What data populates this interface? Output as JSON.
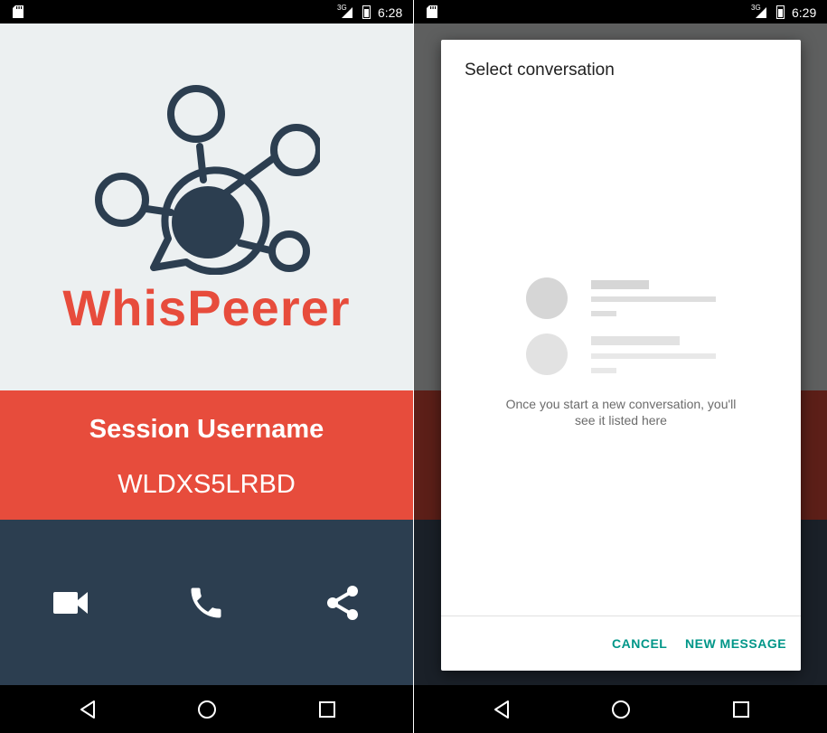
{
  "colors": {
    "brand_red": "#e74c3c",
    "dark_blue": "#2c3e50",
    "light_bg": "#ecf0f1",
    "accent_teal": "#009688"
  },
  "left_screen": {
    "status": {
      "time": "6:28",
      "network": "3G"
    },
    "brand_name": "WhisPeerer",
    "session_label": "Session Username",
    "session_username": "WLDXS5LRBD",
    "actions": [
      {
        "icon": "video-camera-icon"
      },
      {
        "icon": "phone-icon"
      },
      {
        "icon": "share-icon"
      }
    ]
  },
  "right_screen": {
    "status": {
      "time": "6:29",
      "network": "3G"
    },
    "dialog": {
      "title": "Select conversation",
      "empty_line1": "Once you start a new conversation, you'll",
      "empty_line2": "see it listed here",
      "cancel_label": "CANCEL",
      "new_message_label": "NEW MESSAGE"
    }
  },
  "nav_icons": [
    "back-icon",
    "home-icon",
    "recents-icon"
  ]
}
